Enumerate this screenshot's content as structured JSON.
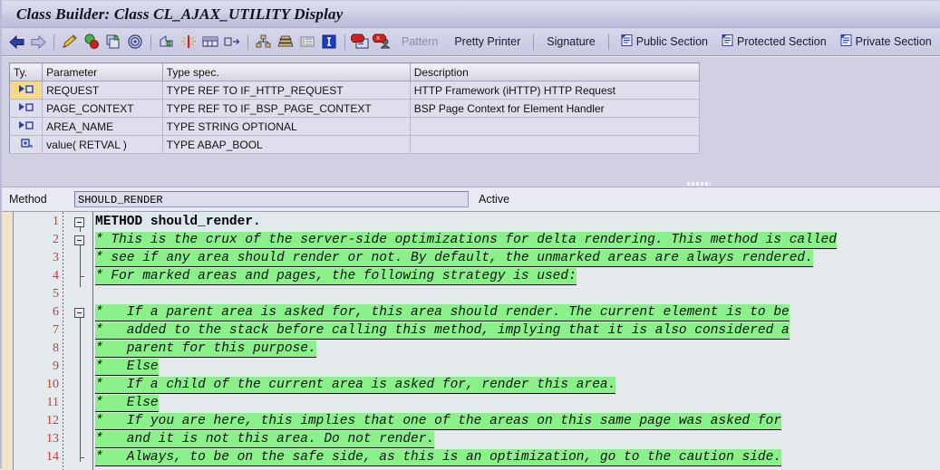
{
  "window": {
    "title": "Class Builder: Class CL_AJAX_UTILITY Display"
  },
  "toolbar": {
    "icons": [
      {
        "name": "back-arrow-icon",
        "label": ""
      },
      {
        "name": "forward-arrow-icon",
        "label": ""
      },
      {
        "name": "pencil-change-icon",
        "label": ""
      },
      {
        "name": "check-syntax-icon",
        "label": ""
      },
      {
        "name": "copy-icon",
        "label": ""
      },
      {
        "name": "other-object-icon",
        "label": ""
      },
      {
        "name": "display-object-list-icon",
        "label": ""
      },
      {
        "name": "insert-icon",
        "label": ""
      },
      {
        "name": "testing-tool-icon",
        "label": ""
      },
      {
        "name": "where-used-list-icon",
        "label": ""
      },
      {
        "name": "class-hierarchy-icon",
        "label": ""
      },
      {
        "name": "inheritance-icon",
        "label": ""
      },
      {
        "name": "list-view-icon",
        "label": ""
      },
      {
        "name": "info-icon",
        "label": ""
      },
      {
        "name": "stop-display-icon",
        "label": ""
      },
      {
        "name": "stop-user-icon",
        "label": ""
      }
    ],
    "pattern_label": "Pattern",
    "pretty_printer_label": "Pretty Printer",
    "signature_label": "Signature",
    "public_section_label": "Public Section",
    "protected_section_label": "Protected Section",
    "private_section_label": "Private Section"
  },
  "parameters": {
    "headers": [
      "Ty.",
      "Parameter",
      "Type spec.",
      "Description"
    ],
    "rows": [
      {
        "ty_icon": "importing-parameter-icon",
        "parameter": "REQUEST",
        "type_spec": "TYPE REF TO IF_HTTP_REQUEST",
        "description": "HTTP Framework (iHTTP) HTTP Request",
        "selected": true
      },
      {
        "ty_icon": "importing-parameter-icon",
        "parameter": "PAGE_CONTEXT",
        "type_spec": "TYPE REF TO IF_BSP_PAGE_CONTEXT",
        "description": "BSP Page Context for Element Handler",
        "selected": false
      },
      {
        "ty_icon": "importing-parameter-icon",
        "parameter": "AREA_NAME",
        "type_spec": "TYPE STRING OPTIONAL",
        "description": "",
        "selected": false
      },
      {
        "ty_icon": "returning-parameter-icon",
        "parameter": "value( RETVAL )",
        "type_spec": "TYPE ABAP_BOOL",
        "description": "",
        "selected": false
      }
    ]
  },
  "method_bar": {
    "label": "Method",
    "value": "SHOULD_RENDER",
    "status": "Active"
  },
  "code": {
    "line_numbers": [
      "1",
      "2",
      "3",
      "4",
      "5",
      "6",
      "7",
      "8",
      "9",
      "10",
      "11",
      "12",
      "13",
      "14"
    ],
    "lines": [
      {
        "n": "1",
        "kind": "kw",
        "text": "METHOD should_render."
      },
      {
        "n": "2",
        "kind": "cmt",
        "text": "* This is the crux of the server-side optimizations for delta rendering. This method is called"
      },
      {
        "n": "3",
        "kind": "cmt",
        "text": "* see if any area should render or not. By default, the unmarked areas are always rendered."
      },
      {
        "n": "4",
        "kind": "cmt",
        "text": "* For marked areas and pages, the following strategy is used:"
      },
      {
        "n": "5",
        "kind": "blank",
        "text": ""
      },
      {
        "n": "6",
        "kind": "cmt",
        "text": "*   If a parent area is asked for, this area should render. The current element is to be"
      },
      {
        "n": "7",
        "kind": "cmt",
        "text": "*   added to the stack before calling this method, implying that it is also considered a"
      },
      {
        "n": "8",
        "kind": "cmt",
        "text": "*   parent for this purpose."
      },
      {
        "n": "9",
        "kind": "cmt",
        "text": "*   Else"
      },
      {
        "n": "10",
        "kind": "cmt",
        "text": "*   If a child of the current area is asked for, render this area."
      },
      {
        "n": "11",
        "kind": "cmt",
        "text": "*   Else"
      },
      {
        "n": "12",
        "kind": "cmt",
        "text": "*   If you are here, this implies that one of the areas on this same page was asked for"
      },
      {
        "n": "13",
        "kind": "cmt",
        "text": "*   and it is not this area. Do not render."
      },
      {
        "n": "14",
        "kind": "cmt",
        "text": "*   Always, to be on the safe side, as this is an optimization, go to the caution side."
      }
    ]
  },
  "colors": {
    "titlebar": "#cfcfe5",
    "toolbar": "#cfcfe5",
    "panel": "#d0d0e2",
    "table_row": "#dedeed",
    "selected_row": "#f5d98b",
    "comment_highlight": "#8af08a",
    "keyword_highlight": "#dde8ee",
    "line_number": "#e03030",
    "editor_bg": "#e4eaec",
    "gutter_tan": "#f0e4cd"
  }
}
